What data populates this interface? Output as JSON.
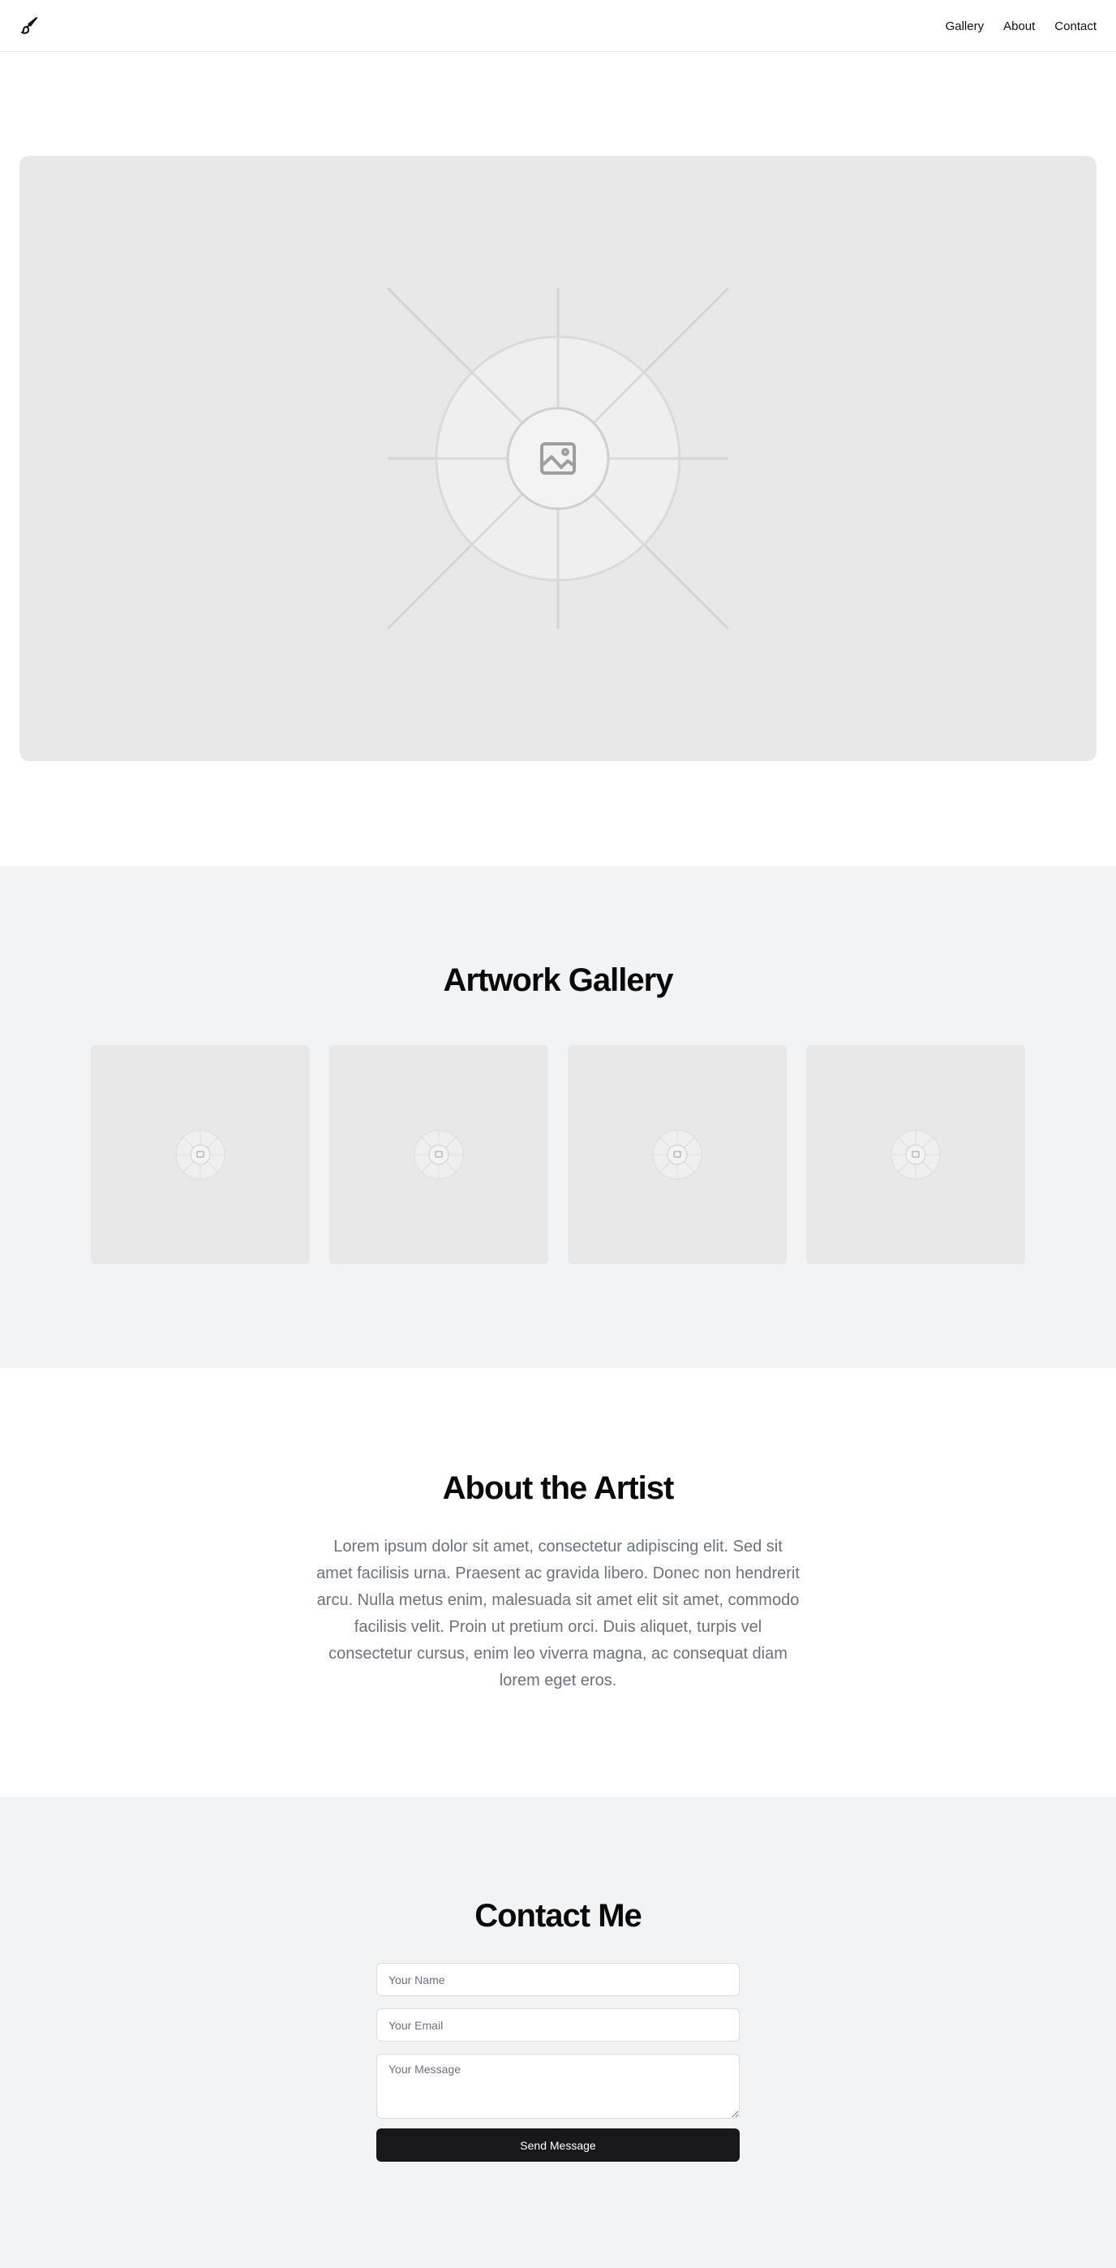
{
  "header": {
    "logo_icon": "paintbrush-icon",
    "nav": [
      {
        "label": "Gallery"
      },
      {
        "label": "About"
      },
      {
        "label": "Contact"
      }
    ]
  },
  "hero": {
    "image_icon": "image-placeholder-icon"
  },
  "gallery": {
    "title": "Artwork Gallery",
    "items": [
      {
        "icon": "image-placeholder-icon"
      },
      {
        "icon": "image-placeholder-icon"
      },
      {
        "icon": "image-placeholder-icon"
      },
      {
        "icon": "image-placeholder-icon"
      }
    ]
  },
  "about": {
    "title": "About the Artist",
    "body": "Lorem ipsum dolor sit amet, consectetur adipiscing elit. Sed sit amet facilisis urna. Praesent ac gravida libero. Donec non hendrerit arcu. Nulla metus enim, malesuada sit amet elit sit amet, commodo facilisis velit. Proin ut pretium orci. Duis aliquet, turpis vel consectetur cursus, enim leo viverra magna, ac consequat diam lorem eget eros."
  },
  "contact": {
    "title": "Contact Me",
    "name_placeholder": "Your Name",
    "email_placeholder": "Your Email",
    "message_placeholder": "Your Message",
    "send_label": "Send Message"
  },
  "colors": {
    "placeholder_bg": "#e8e8e8",
    "section_bg": "#f2f3f5",
    "button_bg": "#18181b",
    "muted_text": "#6b7280"
  }
}
